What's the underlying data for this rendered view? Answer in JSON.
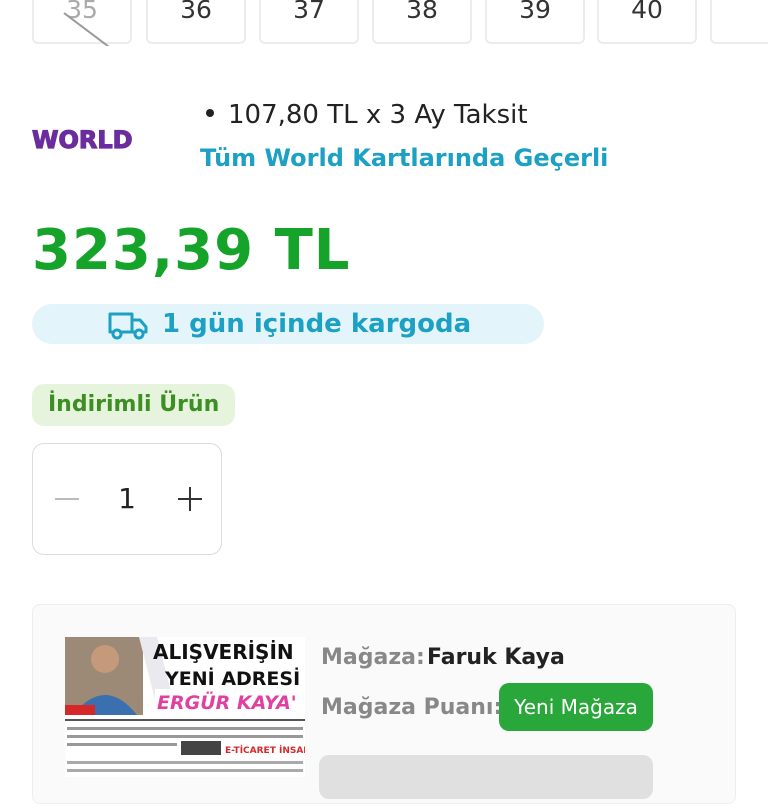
{
  "sizes": [
    "35",
    "36",
    "37",
    "38",
    "39",
    "40"
  ],
  "world": {
    "logo_text": "WORLD",
    "installment": "107,80 TL x 3 Ay Taksit",
    "note": "Tüm World Kartlarında Geçerli"
  },
  "price": "323,39 TL",
  "shipping": {
    "text": "1 gün içinde kargoda",
    "icon": "truck-icon"
  },
  "badge": "İndirimli Ürün",
  "quantity": "1",
  "store": {
    "name_label": "Mağaza:",
    "name": "Faruk Kaya",
    "rating_label": "Mağaza Puanı:",
    "rating_badge": "Yeni Mağaza",
    "image_lines": [
      "ALIŞVERİŞİN",
      "YENİ ADRESİ",
      "ERGÜR KAYA'",
      "E-TİCARET İNSANLARIN"
    ]
  },
  "colors": {
    "price": "#16a32a",
    "accent": "#1ca0c3",
    "world": "#6b2d9e",
    "badge_green": "#29a73a"
  }
}
